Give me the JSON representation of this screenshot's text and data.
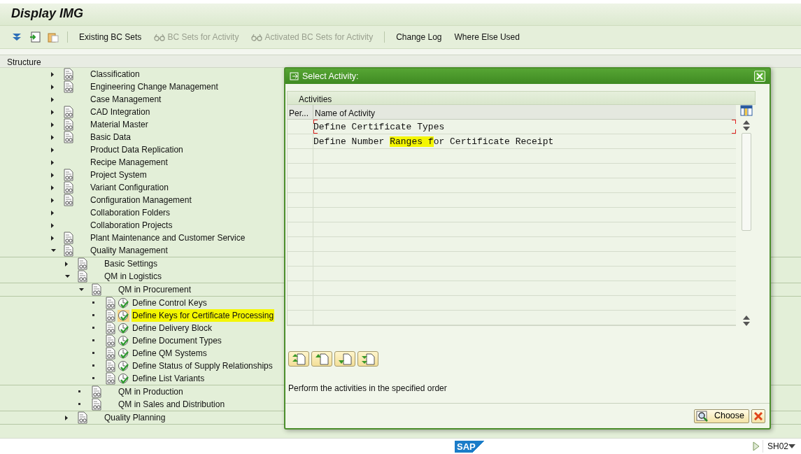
{
  "window": {
    "title": "Display IMG"
  },
  "toolbar": [
    {
      "kind": "icon"
    },
    {
      "kind": "icon"
    },
    {
      "kind": "icon"
    },
    {
      "kind": "separator"
    },
    {
      "kind": "text",
      "label": "Existing BC Sets",
      "disabled": false,
      "glasses": false
    },
    {
      "kind": "text",
      "label": "BC Sets for Activity",
      "disabled": true,
      "glasses": true
    },
    {
      "kind": "text",
      "label": "Activated BC Sets for Activity",
      "disabled": true,
      "glasses": true
    },
    {
      "kind": "separator"
    },
    {
      "kind": "text",
      "label": "Change Log",
      "disabled": false,
      "glasses": false
    },
    {
      "kind": "text",
      "label": "Where Else Used",
      "disabled": false,
      "glasses": false
    }
  ],
  "structure": {
    "header": "Structure",
    "items": [
      {
        "label": "Classification",
        "kind": "folder",
        "expanded": false,
        "doc": true,
        "activity": false,
        "highlighted": false
      },
      {
        "label": "Engineering Change Management",
        "kind": "folder",
        "expanded": false,
        "doc": true,
        "activity": false,
        "highlighted": false
      },
      {
        "label": "Case Management",
        "kind": "folder",
        "expanded": false,
        "doc": false,
        "activity": false,
        "highlighted": false
      },
      {
        "label": "CAD Integration",
        "kind": "folder",
        "expanded": false,
        "doc": true,
        "activity": false,
        "highlighted": false
      },
      {
        "label": "Material Master",
        "kind": "folder",
        "expanded": false,
        "doc": true,
        "activity": false,
        "highlighted": false
      },
      {
        "label": "Basic Data",
        "kind": "folder",
        "expanded": false,
        "doc": true,
        "activity": false,
        "highlighted": false
      },
      {
        "label": "Product Data Replication",
        "kind": "folder",
        "expanded": false,
        "doc": false,
        "activity": false,
        "highlighted": false
      },
      {
        "label": "Recipe Management",
        "kind": "folder",
        "expanded": false,
        "doc": false,
        "activity": false,
        "highlighted": false
      },
      {
        "label": "Project System",
        "kind": "folder",
        "expanded": false,
        "doc": true,
        "activity": false,
        "highlighted": false
      },
      {
        "label": "Variant Configuration",
        "kind": "folder",
        "expanded": false,
        "doc": true,
        "activity": false,
        "highlighted": false
      },
      {
        "label": "Configuration Management",
        "kind": "folder",
        "expanded": false,
        "doc": true,
        "activity": false,
        "highlighted": false
      },
      {
        "label": "Collaboration Folders",
        "kind": "folder",
        "expanded": false,
        "doc": false,
        "activity": false,
        "highlighted": false
      },
      {
        "label": "Collaboration Projects",
        "kind": "folder",
        "expanded": false,
        "doc": false,
        "activity": false,
        "highlighted": false
      },
      {
        "label": "Plant Maintenance and Customer Service",
        "kind": "folder",
        "expanded": false,
        "doc": true,
        "activity": false,
        "highlighted": false
      },
      {
        "label": "Quality Management",
        "kind": "folder",
        "expanded": true,
        "doc": true,
        "activity": false,
        "highlighted": false,
        "children": [
          {
            "label": "Basic Settings",
            "kind": "folder",
            "expanded": false,
            "doc": true,
            "activity": false,
            "highlighted": false
          },
          {
            "label": "QM in Logistics",
            "kind": "folder",
            "expanded": true,
            "doc": true,
            "activity": false,
            "highlighted": false,
            "children": [
              {
                "label": "QM in Procurement",
                "kind": "folder",
                "expanded": true,
                "doc": true,
                "activity": false,
                "highlighted": false,
                "children": [
                  {
                    "label": "Define Control Keys",
                    "kind": "leaf",
                    "doc": true,
                    "activity": true,
                    "highlighted": false
                  },
                  {
                    "label": "Define Keys for Certificate Processing",
                    "kind": "leaf",
                    "doc": true,
                    "activity": true,
                    "highlighted": true
                  },
                  {
                    "label": "Define Delivery Block",
                    "kind": "leaf",
                    "doc": true,
                    "activity": true,
                    "highlighted": false
                  },
                  {
                    "label": "Define Document Types",
                    "kind": "leaf",
                    "doc": true,
                    "activity": true,
                    "highlighted": false
                  },
                  {
                    "label": "Define QM Systems",
                    "kind": "leaf",
                    "doc": true,
                    "activity": true,
                    "highlighted": false
                  },
                  {
                    "label": "Define Status of Supply Relationships",
                    "kind": "leaf",
                    "doc": true,
                    "activity": true,
                    "highlighted": false
                  },
                  {
                    "label": "Define List Variants",
                    "kind": "leaf",
                    "doc": true,
                    "activity": true,
                    "highlighted": false
                  }
                ]
              },
              {
                "label": "QM in Production",
                "kind": "leaf",
                "doc": true,
                "activity": false,
                "highlighted": false
              },
              {
                "label": "QM in Sales and Distribution",
                "kind": "leaf",
                "doc": true,
                "activity": false,
                "highlighted": false
              }
            ]
          },
          {
            "label": "Quality Planning",
            "kind": "folder",
            "expanded": false,
            "doc": true,
            "activity": false,
            "highlighted": false
          }
        ]
      }
    ]
  },
  "dialog": {
    "title": "Select Activity:",
    "section": "Activities",
    "columns": [
      "Per...",
      "Name of Activity"
    ],
    "rows": [
      {
        "focused": true,
        "parts": [
          {
            "text": "Define Certificate Types",
            "highlighted": false
          }
        ]
      },
      {
        "focused": false,
        "parts": [
          {
            "text": "Define Number ",
            "highlighted": false
          },
          {
            "text": "Ranges f",
            "highlighted": true
          },
          {
            "text": "or Certificate Receipt",
            "highlighted": false
          }
        ]
      }
    ],
    "order_buttons": [
      {
        "kind": "top"
      },
      {
        "kind": "up"
      },
      {
        "kind": "down"
      },
      {
        "kind": "bottom"
      }
    ],
    "message": "Perform the activities in the specified order",
    "choose": "Choose"
  },
  "status_bar": {
    "logo": "SAP",
    "system": "SH02"
  }
}
